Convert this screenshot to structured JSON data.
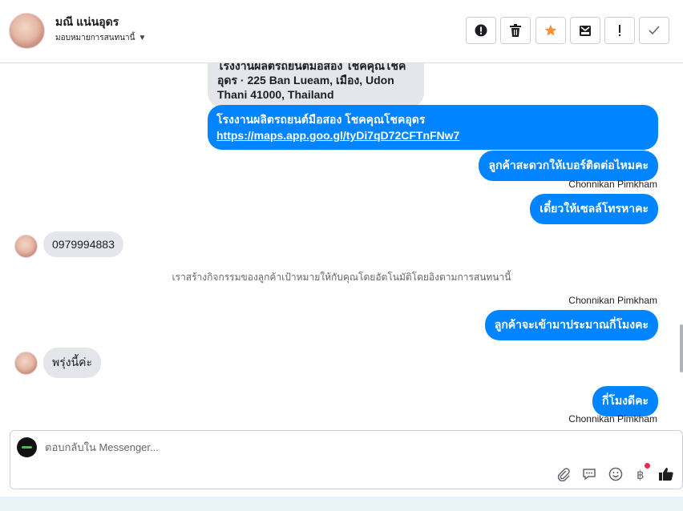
{
  "header": {
    "contact_name": "มณี แน่นอุดร",
    "assign_label": "มอบหมายการสนทนานี้",
    "buttons": [
      {
        "icon": "alert-circle-icon"
      },
      {
        "icon": "trash-icon"
      },
      {
        "icon": "star-icon",
        "color": "#f7923b"
      },
      {
        "icon": "archive-icon"
      },
      {
        "icon": "exclamation-icon"
      },
      {
        "icon": "checkmark-icon"
      }
    ]
  },
  "thread": {
    "messages": [
      {
        "direction": "in",
        "text": "โรงงานผลิตรถยนต์มือสอง โชคคุณโชคอุดร · 225 Ban Lueam, เมือง, Udon Thani 41000, Thailand"
      },
      {
        "direction": "out",
        "text": "โรงงานผลิตรถยนต์มือสอง โชคคุณโชคอุดร",
        "link": "https://maps.app.goo.gl/tyDi7qD72CFTnFNw7"
      },
      {
        "direction": "out",
        "text": "ลูกค้าสะดวกให้เบอร์ติดต่อไหมคะ"
      },
      {
        "sender": "Chonnikan Pimkham"
      },
      {
        "direction": "out",
        "text": "เดี๋ยวให้เซลล์โทรหาคะ"
      },
      {
        "direction": "in",
        "text": "0979994883"
      },
      {
        "system": "เราสร้างกิจกรรมของลูกค้าเป้าหมายให้กับคุณโดยอัตโนมัติโดยอิงตามการสนทนานี้"
      },
      {
        "sender": "Chonnikan Pimkham"
      },
      {
        "direction": "out",
        "text": "ลูกค้าจะเข้ามาประมาณกี่โมงคะ"
      },
      {
        "direction": "in",
        "text": "พรุ่งนี้ค่ะ"
      },
      {
        "direction": "out",
        "text": "กี่โมงดีคะ"
      },
      {
        "sender": "Chonnikan Pimkham"
      }
    ]
  },
  "composer": {
    "placeholder": "ตอบกลับใน Messenger...",
    "tools": [
      "paperclip-icon",
      "message-icon",
      "emoji-icon",
      "baht-icon",
      "thumbs-up-icon"
    ]
  },
  "colors": {
    "accent": "#0084ff",
    "incoming": "#e4e6eb",
    "notification": "#f02849"
  }
}
